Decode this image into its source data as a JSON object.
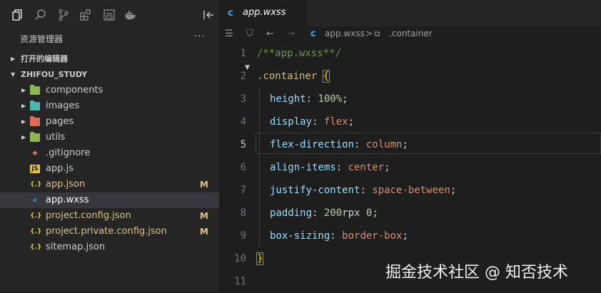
{
  "sidebar": {
    "activity_icons": [
      "files-icon",
      "search-icon",
      "source-control-icon",
      "extensions-icon",
      "outline-icon",
      "docker-icon",
      "collapse-sidebar-icon"
    ],
    "explorer_title": "资源管理器",
    "more_label": "···",
    "sections": [
      {
        "label": "打开的编辑器",
        "expanded": false
      },
      {
        "label": "ZHIFOU_STUDY",
        "expanded": true
      }
    ],
    "tree": [
      {
        "label": "components",
        "type": "folder",
        "icon": "folder-components-icon",
        "expanded": false,
        "git": "",
        "modified": false,
        "selected": false
      },
      {
        "label": "images",
        "type": "folder",
        "icon": "folder-images-icon",
        "expanded": false,
        "git": "",
        "modified": false,
        "selected": false
      },
      {
        "label": "pages",
        "type": "folder",
        "icon": "folder-pages-icon",
        "expanded": false,
        "git": "",
        "modified": false,
        "selected": false
      },
      {
        "label": "utils",
        "type": "folder",
        "icon": "folder-utils-icon",
        "expanded": false,
        "git": "",
        "modified": false,
        "selected": false
      },
      {
        "label": ".gitignore",
        "type": "file",
        "icon": "git-icon",
        "git": "",
        "modified": false,
        "selected": false
      },
      {
        "label": "app.js",
        "type": "file",
        "icon": "js-icon",
        "git": "",
        "modified": false,
        "selected": false
      },
      {
        "label": "app.json",
        "type": "file",
        "icon": "json-icon",
        "git": "M",
        "modified": true,
        "selected": false
      },
      {
        "label": "app.wxss",
        "type": "file",
        "icon": "css-icon",
        "git": "",
        "modified": false,
        "selected": true
      },
      {
        "label": "project.config.json",
        "type": "file",
        "icon": "json-icon",
        "git": "M",
        "modified": true,
        "selected": false
      },
      {
        "label": "project.private.config.json",
        "type": "file",
        "icon": "json-icon",
        "git": "M",
        "modified": true,
        "selected": false
      },
      {
        "label": "sitemap.json",
        "type": "file",
        "icon": "json-icon",
        "git": "",
        "modified": false,
        "selected": false
      }
    ]
  },
  "editor": {
    "tab": {
      "label": "app.wxss",
      "icon": "css-icon"
    },
    "breadcrumbs": {
      "file": "app.wxss",
      "separator": ">",
      "symbol": ".container"
    },
    "active_line": 5,
    "lines": [
      {
        "n": "1",
        "text": "/**app.wxss**/"
      },
      {
        "n": "2",
        "text": ".container {"
      },
      {
        "n": "3",
        "text": "height: 100%;"
      },
      {
        "n": "4",
        "text": "display: flex;"
      },
      {
        "n": "5",
        "text": "flex-direction: column;"
      },
      {
        "n": "6",
        "text": "align-items: center;"
      },
      {
        "n": "7",
        "text": "justify-content: space-between;"
      },
      {
        "n": "8",
        "text": "padding: 200rpx 0;"
      },
      {
        "n": "9",
        "text": "box-sizing: border-box;"
      },
      {
        "n": "10",
        "text": "}"
      },
      {
        "n": "11",
        "text": ""
      }
    ]
  },
  "watermark": "掘金技术社区 @ 知否技术",
  "colors": {
    "sidebar_bg": "#252526",
    "editor_bg": "#1e1e1e",
    "selection_bg": "#37373d",
    "modified": "#e2c08d",
    "css_icon": "#42a5f5"
  }
}
